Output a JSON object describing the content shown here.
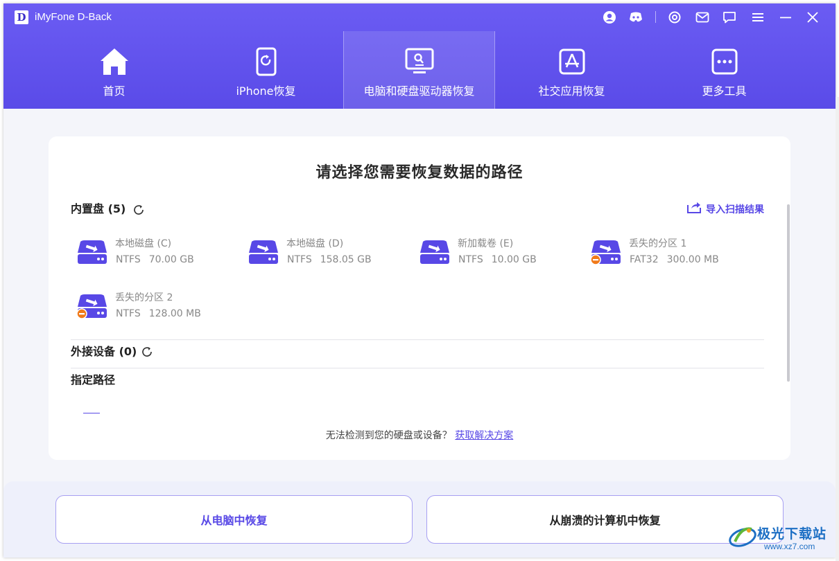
{
  "app": {
    "logo_letter": "D",
    "title": "iMyFone D-Back"
  },
  "titlebar_icons": [
    "user-icon",
    "discord-icon",
    "settings-icon",
    "mail-icon",
    "feedback-icon",
    "menu-icon",
    "minimize-icon",
    "close-icon"
  ],
  "tabs": [
    {
      "label": "首页",
      "icon": "home-icon",
      "active": false
    },
    {
      "label": "iPhone恢复",
      "icon": "iphone-icon",
      "active": false
    },
    {
      "label": "电脑和硬盘驱动器恢复",
      "icon": "computer-icon",
      "active": true
    },
    {
      "label": "社交应用恢复",
      "icon": "app-store-icon",
      "active": false
    },
    {
      "label": "更多工具",
      "icon": "more-icon",
      "active": false
    }
  ],
  "card": {
    "title": "请选择您需要恢复数据的路径",
    "internal_title": "内置盘 (5)",
    "import_label": "导入扫描结果",
    "external_title": "外接设备 (0)",
    "custom_path_title": "指定路径",
    "help_text": "无法检测到您的硬盘或设备？",
    "help_link": "获取解决方案"
  },
  "drives": [
    {
      "name": "本地磁盘 (C)",
      "fs": "NTFS",
      "size": "70.00 GB",
      "lost": false
    },
    {
      "name": "本地磁盘 (D)",
      "fs": "NTFS",
      "size": "158.05 GB",
      "lost": false
    },
    {
      "name": "新加载卷 (E)",
      "fs": "NTFS",
      "size": "10.00 GB",
      "lost": false
    },
    {
      "name": "丢失的分区 1",
      "fs": "FAT32",
      "size": "300.00 MB",
      "lost": true
    },
    {
      "name": "丢失的分区 2",
      "fs": "NTFS",
      "size": "128.00 MB",
      "lost": true
    }
  ],
  "bottom": {
    "recover_pc": "从电脑中恢复",
    "recover_crash": "从崩溃的计算机中恢复"
  },
  "watermark": {
    "text": "极光下载站",
    "url": "www.xz7.com"
  },
  "colors": {
    "header": "#6b5cf3",
    "accent": "#5848e6",
    "lost_badge": "#f07a1a"
  }
}
